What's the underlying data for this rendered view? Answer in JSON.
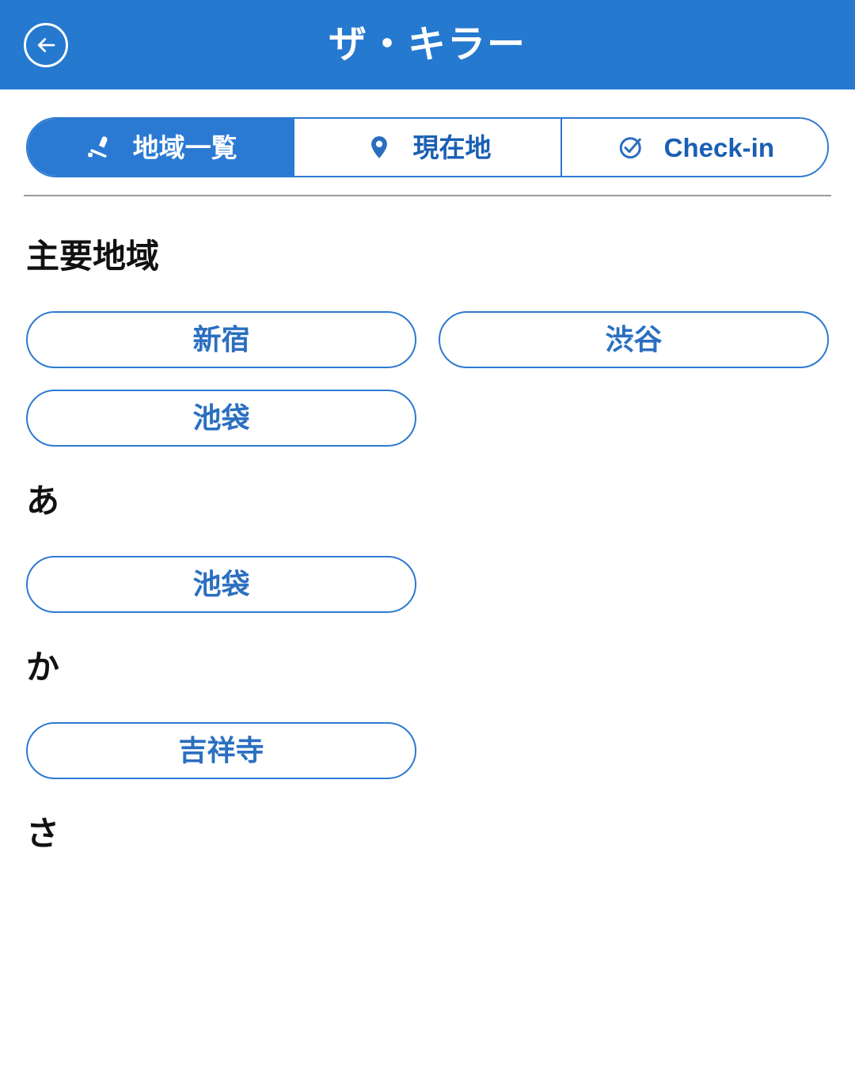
{
  "header": {
    "title": "ザ・キラー",
    "back_icon": "arrow-left-circle-icon",
    "background_color": "#2579cf",
    "text_color": "#ffffff"
  },
  "tabs": {
    "accent_color": "#2a7ad4",
    "items": [
      {
        "label": "地域一覧",
        "icon": "seat-list-icon",
        "active": true
      },
      {
        "label": "現在地",
        "icon": "map-pin-icon",
        "active": false
      },
      {
        "label": "Check-in",
        "icon": "check-circle-icon",
        "active": false
      }
    ]
  },
  "sections": [
    {
      "title": "主要地域",
      "pills": [
        "新宿",
        "渋谷",
        "池袋"
      ]
    },
    {
      "title": "あ",
      "pills": [
        "池袋"
      ]
    },
    {
      "title": "か",
      "pills": [
        "吉祥寺"
      ]
    },
    {
      "title": "さ",
      "pills": []
    }
  ]
}
